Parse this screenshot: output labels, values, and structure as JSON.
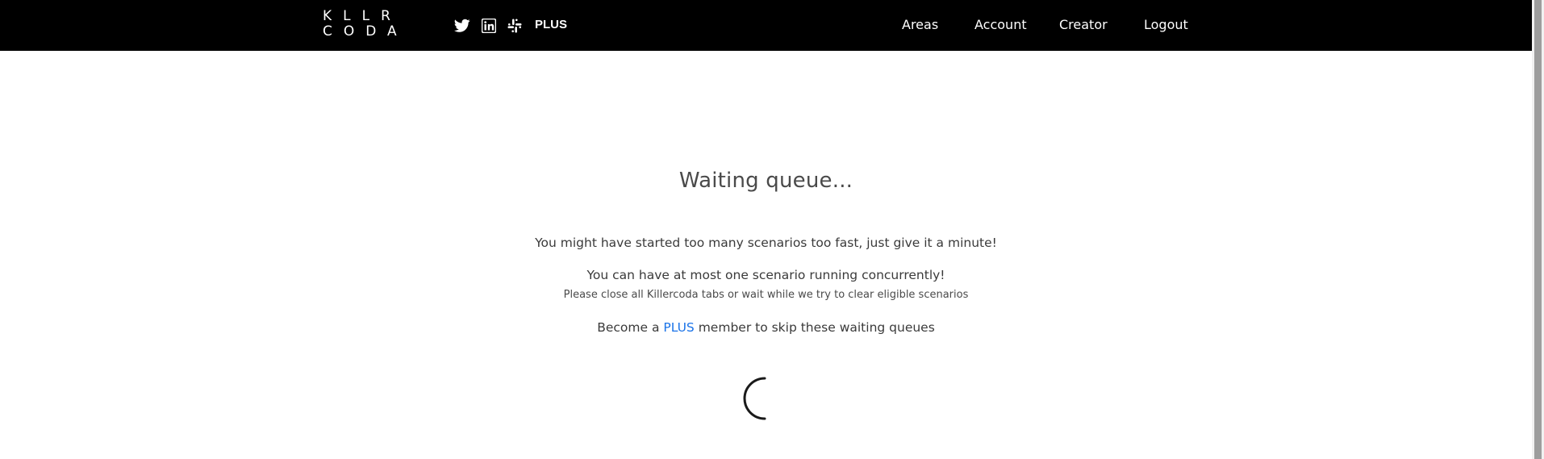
{
  "header": {
    "logo": {
      "line1": "KLLR",
      "line2": "CODA"
    },
    "social": {
      "twitter_icon": "twitter-icon",
      "linkedin_icon": "linkedin-icon",
      "slack_icon": "slack-icon"
    },
    "plus_label": "PLUS",
    "nav": {
      "areas": "Areas",
      "account": "Account",
      "creator": "Creator",
      "logout": "Logout"
    }
  },
  "main": {
    "title": "Waiting queue...",
    "message_1": "You might have started too many scenarios too fast, just give it a minute!",
    "message_2": "You can have at most one scenario running concurrently!",
    "message_3": "Please close all Killercoda tabs or wait while we try to clear eligible scenarios",
    "message_4_prefix": "Become a ",
    "message_4_link": "PLUS",
    "message_4_suffix": " member to skip these waiting queues",
    "spinner_icon": "loading-spinner-icon"
  },
  "colors": {
    "header_bg": "#000000",
    "link_blue": "#1a73e8",
    "text_dark": "#3a3a3a"
  }
}
